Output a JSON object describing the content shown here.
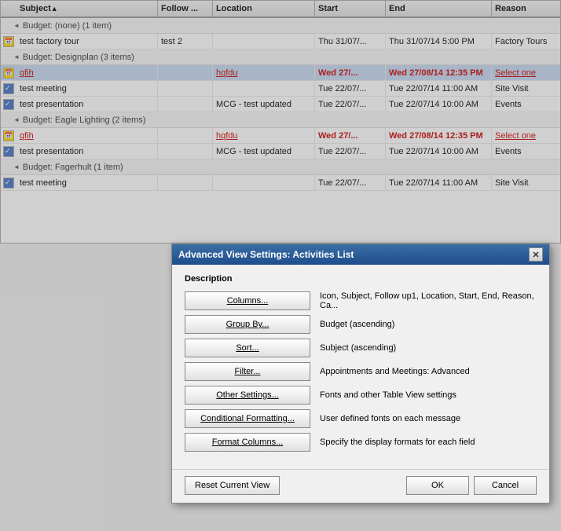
{
  "columns": [
    {
      "label": "Subject",
      "class": "w-subject",
      "sorted": true
    },
    {
      "label": "Follow ...",
      "class": "w-followup"
    },
    {
      "label": "Location",
      "class": "w-location"
    },
    {
      "label": "Start",
      "class": "w-start"
    },
    {
      "label": "End",
      "class": "w-end"
    },
    {
      "label": "Reason",
      "class": "w-reason"
    }
  ],
  "groups": [
    {
      "label": "Budget: (none) (1 item)",
      "rows": [
        {
          "icon": "cal",
          "subject": "test factory tour",
          "followup": "test 2",
          "location": "",
          "start": "Thu 31/07/...",
          "end": "Thu 31/07/14 5:00 PM",
          "reason": "Factory Tours",
          "selected": false
        }
      ]
    },
    {
      "label": "Budget: Designplan (3 items)",
      "rows": [
        {
          "icon": "cal",
          "subject": "qfih",
          "followup": "",
          "location": "hqfdu",
          "start": "Wed 27/...",
          "end": "Wed 27/08/14 12:35 PM",
          "reason": "Select one",
          "selected": true,
          "red": true
        },
        {
          "icon": "task",
          "subject": "test meeting",
          "followup": "",
          "location": "",
          "start": "Tue 22/07/...",
          "end": "Tue 22/07/14 11:00 AM",
          "reason": "Site Visit",
          "selected": false
        },
        {
          "icon": "task",
          "subject": "test presentation",
          "followup": "",
          "location": "MCG - test updated",
          "start": "Tue 22/07/...",
          "end": "Tue 22/07/14 10:00 AM",
          "reason": "Events",
          "selected": false
        }
      ]
    },
    {
      "label": "Budget: Eagle Lighting (2 items)",
      "rows": [
        {
          "icon": "cal",
          "subject": "qfih",
          "followup": "",
          "location": "hqfdu",
          "start": "Wed 27/...",
          "end": "Wed 27/08/14 12:35 PM",
          "reason": "Select one",
          "selected": false,
          "red": true
        },
        {
          "icon": "task",
          "subject": "test presentation",
          "followup": "",
          "location": "MCG - test updated",
          "start": "Tue 22/07/...",
          "end": "Tue 22/07/14 10:00 AM",
          "reason": "Events",
          "selected": false
        }
      ]
    },
    {
      "label": "Budget: Fagerhult (1 item)",
      "rows": [
        {
          "icon": "task",
          "subject": "test meeting",
          "followup": "",
          "location": "",
          "start": "Tue 22/07/...",
          "end": "Tue 22/07/14 11:00 AM",
          "reason": "Site Visit",
          "selected": false
        }
      ]
    }
  ],
  "dialog": {
    "title": "Advanced View Settings: Activities List",
    "description_label": "Description",
    "rows": [
      {
        "button": "Columns...",
        "value": "Icon, Subject, Follow up1, Location, Start, End, Reason, Ca..."
      },
      {
        "button": "Group By...",
        "value": "Budget (ascending)"
      },
      {
        "button": "Sort...",
        "value": "Subject (ascending)"
      },
      {
        "button": "Filter...",
        "value": "Appointments and Meetings: Advanced"
      },
      {
        "button": "Other Settings...",
        "value": "Fonts and other Table View settings"
      },
      {
        "button": "Conditional Formatting...",
        "value": "User defined fonts on each message"
      },
      {
        "button": "Format Columns...",
        "value": "Specify the display formats for each field"
      }
    ],
    "footer": {
      "reset_label": "Reset Current View",
      "ok_label": "OK",
      "cancel_label": "Cancel"
    }
  }
}
